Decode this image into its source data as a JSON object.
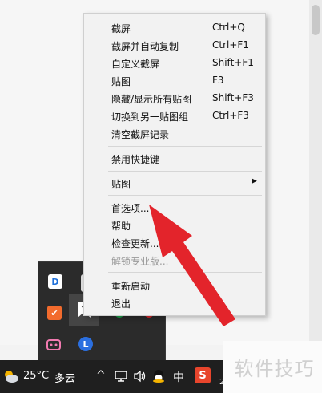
{
  "menu": {
    "items": [
      {
        "label": "截屏",
        "shortcut": "Ctrl+Q"
      },
      {
        "label": "截屏并自动复制",
        "shortcut": "Ctrl+F1"
      },
      {
        "label": "自定义截屏",
        "shortcut": "Shift+F1"
      },
      {
        "label": "贴图",
        "shortcut": "F3"
      },
      {
        "label": "隐藏/显示所有贴图",
        "shortcut": "Shift+F3"
      },
      {
        "label": "切换到另一贴图组",
        "shortcut": "Ctrl+F3"
      },
      {
        "label": "清空截屏记录",
        "shortcut": ""
      },
      {
        "label": "禁用快捷键",
        "shortcut": ""
      },
      {
        "label": "贴图",
        "shortcut": ""
      },
      {
        "label": "首选项...",
        "shortcut": ""
      },
      {
        "label": "帮助",
        "shortcut": ""
      },
      {
        "label": "检查更新...",
        "shortcut": ""
      },
      {
        "label": "解锁专业版...",
        "shortcut": ""
      },
      {
        "label": "重新启动",
        "shortcut": ""
      },
      {
        "label": "退出",
        "shortcut": ""
      }
    ],
    "submenu_arrow": "▶"
  },
  "taskbar": {
    "temperature": "25°C",
    "weather": "多云",
    "chevron": "^",
    "ime": "中",
    "sogou": "S",
    "clock_partial": "2"
  },
  "watermark": "软件技巧",
  "colors": {
    "arrow": "#e3242b",
    "taskbar": "#1f1f1f",
    "menu_bg": "#f2f2f2"
  }
}
